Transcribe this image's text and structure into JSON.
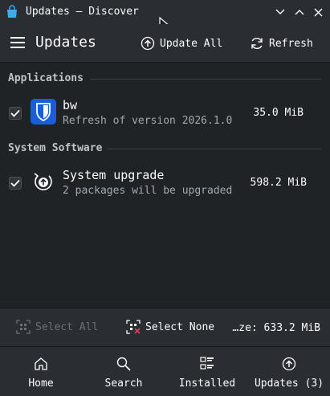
{
  "window": {
    "title": "Updates — Discover"
  },
  "header": {
    "title": "Updates",
    "update_all_label": "Update All",
    "refresh_label": "Refresh"
  },
  "sections": [
    {
      "title": "Applications",
      "items": [
        {
          "name": "bw",
          "description": "Refresh of version 2026.1.0",
          "size": "35.0 MiB",
          "checked": true,
          "icon": "bitwarden-shield-icon"
        }
      ]
    },
    {
      "title": "System Software",
      "items": [
        {
          "name": "System upgrade",
          "description": "2 packages will be upgraded",
          "size": "598.2 MiB",
          "checked": true,
          "icon": "system-upgrade-icon"
        }
      ]
    }
  ],
  "footer": {
    "select_all_label": "Select All",
    "select_none_label": "Select None",
    "total_size": "…ze: 633.2 MiB"
  },
  "nav": {
    "items": [
      {
        "label": "Home",
        "icon": "home-icon"
      },
      {
        "label": "Search",
        "icon": "search-icon"
      },
      {
        "label": "Installed",
        "icon": "installed-icon"
      },
      {
        "label": "Updates (3)",
        "icon": "updates-icon"
      }
    ]
  },
  "colors": {
    "background": "#202326",
    "bar": "#2a2e32",
    "accent": "#1d99f3",
    "bitwarden": "#175ddc",
    "muted_text": "#a1a9b1"
  }
}
